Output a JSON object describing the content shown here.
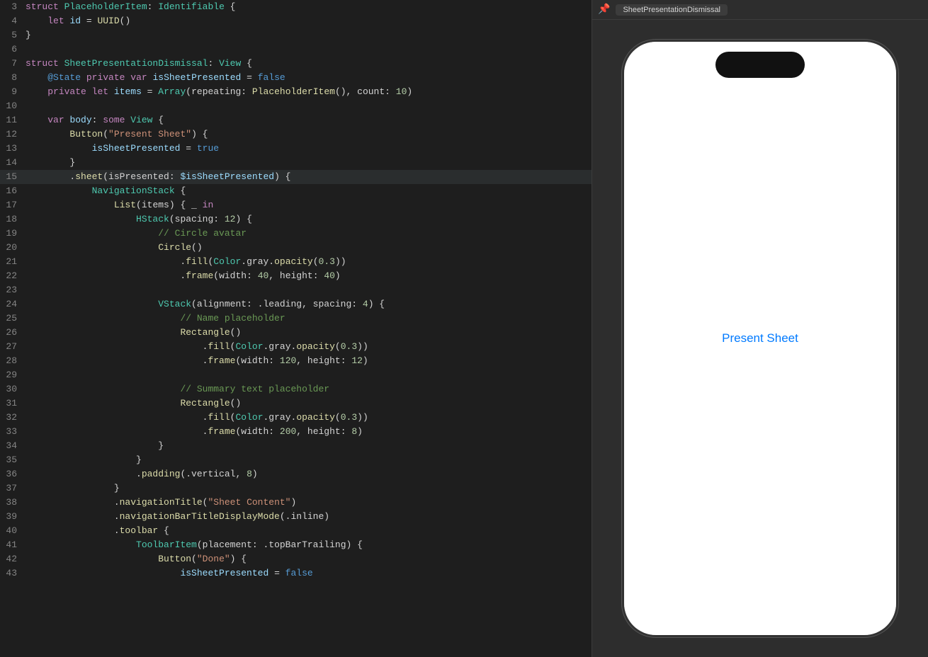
{
  "preview": {
    "tab_label": "SheetPresentationDismissal",
    "present_sheet_button": "Present Sheet"
  },
  "code": {
    "lines": [
      {
        "num": 3,
        "tokens": [
          {
            "t": "kw",
            "v": "struct "
          },
          {
            "t": "type",
            "v": "PlaceholderItem"
          },
          {
            "t": "plain",
            "v": ": "
          },
          {
            "t": "type",
            "v": "Identifiable"
          },
          {
            "t": "plain",
            "v": " {"
          }
        ]
      },
      {
        "num": 4,
        "tokens": [
          {
            "t": "plain",
            "v": "    "
          },
          {
            "t": "kw",
            "v": "let "
          },
          {
            "t": "prop",
            "v": "id"
          },
          {
            "t": "plain",
            "v": " = "
          },
          {
            "t": "func",
            "v": "UUID"
          },
          {
            "t": "plain",
            "v": "()"
          }
        ]
      },
      {
        "num": 5,
        "tokens": [
          {
            "t": "plain",
            "v": "}"
          }
        ]
      },
      {
        "num": 6,
        "tokens": []
      },
      {
        "num": 7,
        "tokens": [
          {
            "t": "kw",
            "v": "struct "
          },
          {
            "t": "type",
            "v": "SheetPresentationDismissal"
          },
          {
            "t": "plain",
            "v": ": "
          },
          {
            "t": "type",
            "v": "View"
          },
          {
            "t": "plain",
            "v": " {"
          }
        ]
      },
      {
        "num": 8,
        "tokens": [
          {
            "t": "plain",
            "v": "    "
          },
          {
            "t": "atmark",
            "v": "@State"
          },
          {
            "t": "plain",
            "v": " "
          },
          {
            "t": "kw",
            "v": "private"
          },
          {
            "t": "plain",
            "v": " "
          },
          {
            "t": "kw",
            "v": "var "
          },
          {
            "t": "prop",
            "v": "isSheetPresented"
          },
          {
            "t": "plain",
            "v": " = "
          },
          {
            "t": "kw2",
            "v": "false"
          }
        ]
      },
      {
        "num": 9,
        "tokens": [
          {
            "t": "plain",
            "v": "    "
          },
          {
            "t": "kw",
            "v": "private"
          },
          {
            "t": "plain",
            "v": " "
          },
          {
            "t": "kw",
            "v": "let "
          },
          {
            "t": "prop",
            "v": "items"
          },
          {
            "t": "plain",
            "v": " = "
          },
          {
            "t": "type",
            "v": "Array"
          },
          {
            "t": "plain",
            "v": "(repeating: "
          },
          {
            "t": "func",
            "v": "PlaceholderItem"
          },
          {
            "t": "plain",
            "v": "(), count: "
          },
          {
            "t": "num",
            "v": "10"
          },
          {
            "t": "plain",
            "v": ")"
          }
        ]
      },
      {
        "num": 10,
        "tokens": []
      },
      {
        "num": 11,
        "tokens": [
          {
            "t": "plain",
            "v": "    "
          },
          {
            "t": "kw",
            "v": "var "
          },
          {
            "t": "prop",
            "v": "body"
          },
          {
            "t": "plain",
            "v": ": "
          },
          {
            "t": "kw",
            "v": "some "
          },
          {
            "t": "type",
            "v": "View"
          },
          {
            "t": "plain",
            "v": " {"
          }
        ]
      },
      {
        "num": 12,
        "tokens": [
          {
            "t": "plain",
            "v": "        "
          },
          {
            "t": "func",
            "v": "Button"
          },
          {
            "t": "plain",
            "v": "("
          },
          {
            "t": "str",
            "v": "\"Present Sheet\""
          },
          {
            "t": "plain",
            "v": ") {"
          }
        ]
      },
      {
        "num": 13,
        "tokens": [
          {
            "t": "plain",
            "v": "            "
          },
          {
            "t": "prop",
            "v": "isSheetPresented"
          },
          {
            "t": "plain",
            "v": " = "
          },
          {
            "t": "kw2",
            "v": "true"
          }
        ]
      },
      {
        "num": 14,
        "tokens": [
          {
            "t": "plain",
            "v": "        }"
          }
        ]
      },
      {
        "num": 15,
        "tokens": [
          {
            "t": "plain",
            "v": "        ."
          },
          {
            "t": "func",
            "v": "sheet"
          },
          {
            "t": "plain",
            "v": "(isPresented: "
          },
          {
            "t": "prop",
            "v": "$isSheetPresented"
          },
          {
            "t": "plain",
            "v": ") {"
          },
          {
            "t": "highlight",
            "v": ""
          }
        ],
        "highlighted": true
      },
      {
        "num": 16,
        "tokens": [
          {
            "t": "plain",
            "v": "            "
          },
          {
            "t": "type",
            "v": "NavigationStack"
          },
          {
            "t": "plain",
            "v": " {"
          }
        ]
      },
      {
        "num": 17,
        "tokens": [
          {
            "t": "plain",
            "v": "                "
          },
          {
            "t": "func",
            "v": "List"
          },
          {
            "t": "plain",
            "v": "(items) { _ "
          },
          {
            "t": "kw",
            "v": "in"
          }
        ]
      },
      {
        "num": 18,
        "tokens": [
          {
            "t": "plain",
            "v": "                    "
          },
          {
            "t": "type",
            "v": "HStack"
          },
          {
            "t": "plain",
            "v": "(spacing: "
          },
          {
            "t": "num",
            "v": "12"
          },
          {
            "t": "plain",
            "v": ") {"
          }
        ]
      },
      {
        "num": 19,
        "tokens": [
          {
            "t": "plain",
            "v": "                        "
          },
          {
            "t": "comment",
            "v": "// Circle avatar"
          }
        ]
      },
      {
        "num": 20,
        "tokens": [
          {
            "t": "plain",
            "v": "                        "
          },
          {
            "t": "func",
            "v": "Circle"
          },
          {
            "t": "plain",
            "v": "()"
          }
        ]
      },
      {
        "num": 21,
        "tokens": [
          {
            "t": "plain",
            "v": "                            ."
          },
          {
            "t": "func",
            "v": "fill"
          },
          {
            "t": "plain",
            "v": "("
          },
          {
            "t": "type",
            "v": "Color"
          },
          {
            "t": "plain",
            "v": ".gray."
          },
          {
            "t": "func",
            "v": "opacity"
          },
          {
            "t": "plain",
            "v": "("
          },
          {
            "t": "num",
            "v": "0.3"
          },
          {
            "t": "plain",
            "v": "))"
          }
        ]
      },
      {
        "num": 22,
        "tokens": [
          {
            "t": "plain",
            "v": "                            ."
          },
          {
            "t": "func",
            "v": "frame"
          },
          {
            "t": "plain",
            "v": "(width: "
          },
          {
            "t": "num",
            "v": "40"
          },
          {
            "t": "plain",
            "v": ", height: "
          },
          {
            "t": "num",
            "v": "40"
          },
          {
            "t": "plain",
            "v": ")"
          }
        ]
      },
      {
        "num": 23,
        "tokens": []
      },
      {
        "num": 24,
        "tokens": [
          {
            "t": "plain",
            "v": "                        "
          },
          {
            "t": "type",
            "v": "VStack"
          },
          {
            "t": "plain",
            "v": "(alignment: .leading, spacing: "
          },
          {
            "t": "num",
            "v": "4"
          },
          {
            "t": "plain",
            "v": ") {"
          }
        ]
      },
      {
        "num": 25,
        "tokens": [
          {
            "t": "plain",
            "v": "                            "
          },
          {
            "t": "comment",
            "v": "// Name placeholder"
          }
        ]
      },
      {
        "num": 26,
        "tokens": [
          {
            "t": "plain",
            "v": "                            "
          },
          {
            "t": "func",
            "v": "Rectangle"
          },
          {
            "t": "plain",
            "v": "()"
          }
        ]
      },
      {
        "num": 27,
        "tokens": [
          {
            "t": "plain",
            "v": "                                ."
          },
          {
            "t": "func",
            "v": "fill"
          },
          {
            "t": "plain",
            "v": "("
          },
          {
            "t": "type",
            "v": "Color"
          },
          {
            "t": "plain",
            "v": ".gray."
          },
          {
            "t": "func",
            "v": "opacity"
          },
          {
            "t": "plain",
            "v": "("
          },
          {
            "t": "num",
            "v": "0.3"
          },
          {
            "t": "plain",
            "v": "))"
          }
        ]
      },
      {
        "num": 28,
        "tokens": [
          {
            "t": "plain",
            "v": "                                ."
          },
          {
            "t": "func",
            "v": "frame"
          },
          {
            "t": "plain",
            "v": "(width: "
          },
          {
            "t": "num",
            "v": "120"
          },
          {
            "t": "plain",
            "v": ", height: "
          },
          {
            "t": "num",
            "v": "12"
          },
          {
            "t": "plain",
            "v": ")"
          }
        ]
      },
      {
        "num": 29,
        "tokens": []
      },
      {
        "num": 30,
        "tokens": [
          {
            "t": "plain",
            "v": "                            "
          },
          {
            "t": "comment",
            "v": "// Summary text placeholder"
          }
        ]
      },
      {
        "num": 31,
        "tokens": [
          {
            "t": "plain",
            "v": "                            "
          },
          {
            "t": "func",
            "v": "Rectangle"
          },
          {
            "t": "plain",
            "v": "()"
          }
        ]
      },
      {
        "num": 32,
        "tokens": [
          {
            "t": "plain",
            "v": "                                ."
          },
          {
            "t": "func",
            "v": "fill"
          },
          {
            "t": "plain",
            "v": "("
          },
          {
            "t": "type",
            "v": "Color"
          },
          {
            "t": "plain",
            "v": ".gray."
          },
          {
            "t": "func",
            "v": "opacity"
          },
          {
            "t": "plain",
            "v": "("
          },
          {
            "t": "num",
            "v": "0.3"
          },
          {
            "t": "plain",
            "v": "))"
          }
        ]
      },
      {
        "num": 33,
        "tokens": [
          {
            "t": "plain",
            "v": "                                ."
          },
          {
            "t": "func",
            "v": "frame"
          },
          {
            "t": "plain",
            "v": "(width: "
          },
          {
            "t": "num",
            "v": "200"
          },
          {
            "t": "plain",
            "v": ", height: "
          },
          {
            "t": "num",
            "v": "8"
          },
          {
            "t": "plain",
            "v": ")"
          }
        ]
      },
      {
        "num": 34,
        "tokens": [
          {
            "t": "plain",
            "v": "                        }"
          }
        ]
      },
      {
        "num": 35,
        "tokens": [
          {
            "t": "plain",
            "v": "                    }"
          }
        ]
      },
      {
        "num": 36,
        "tokens": [
          {
            "t": "plain",
            "v": "                    ."
          },
          {
            "t": "func",
            "v": "padding"
          },
          {
            "t": "plain",
            "v": "(.vertical, "
          },
          {
            "t": "num",
            "v": "8"
          },
          {
            "t": "plain",
            "v": ")"
          }
        ]
      },
      {
        "num": 37,
        "tokens": [
          {
            "t": "plain",
            "v": "                }"
          }
        ]
      },
      {
        "num": 38,
        "tokens": [
          {
            "t": "plain",
            "v": "                ."
          },
          {
            "t": "func",
            "v": "navigationTitle"
          },
          {
            "t": "plain",
            "v": "("
          },
          {
            "t": "str",
            "v": "\"Sheet Content\""
          },
          {
            "t": "plain",
            "v": ")"
          }
        ]
      },
      {
        "num": 39,
        "tokens": [
          {
            "t": "plain",
            "v": "                ."
          },
          {
            "t": "func",
            "v": "navigationBarTitleDisplayMode"
          },
          {
            "t": "plain",
            "v": "(.inline)"
          }
        ]
      },
      {
        "num": 40,
        "tokens": [
          {
            "t": "plain",
            "v": "                ."
          },
          {
            "t": "func",
            "v": "toolbar"
          },
          {
            "t": "plain",
            "v": " {"
          }
        ]
      },
      {
        "num": 41,
        "tokens": [
          {
            "t": "plain",
            "v": "                    "
          },
          {
            "t": "type",
            "v": "ToolbarItem"
          },
          {
            "t": "plain",
            "v": "(placement: .topBarTrailing) {"
          }
        ]
      },
      {
        "num": 42,
        "tokens": [
          {
            "t": "plain",
            "v": "                        "
          },
          {
            "t": "func",
            "v": "Button"
          },
          {
            "t": "plain",
            "v": "("
          },
          {
            "t": "str",
            "v": "\"Done\""
          },
          {
            "t": "plain",
            "v": ") {"
          }
        ]
      },
      {
        "num": 43,
        "tokens": [
          {
            "t": "plain",
            "v": "                            "
          },
          {
            "t": "prop",
            "v": "isSheetPresented"
          },
          {
            "t": "plain",
            "v": " = "
          },
          {
            "t": "kw2",
            "v": "false"
          }
        ]
      }
    ]
  }
}
